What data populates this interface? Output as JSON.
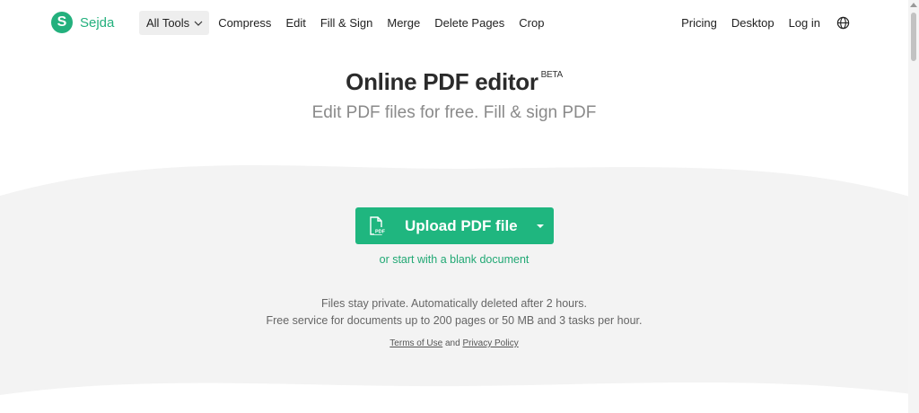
{
  "nav": {
    "logo_text": "Sejda",
    "logo_letter": "S",
    "all_tools": "All Tools",
    "links": [
      "Compress",
      "Edit",
      "Fill & Sign",
      "Merge",
      "Delete Pages",
      "Crop"
    ],
    "right_links": [
      "Pricing",
      "Desktop",
      "Log in"
    ],
    "icons": {
      "globe": "globe-icon",
      "chevron": "chevron-down-icon"
    }
  },
  "hero": {
    "title": "Online PDF editor",
    "badge": "BETA",
    "subtitle": "Edit PDF files for free. Fill & sign PDF"
  },
  "upload": {
    "label": "Upload PDF file",
    "icon": "pdf-file-icon",
    "icon_text": "PDF",
    "blank_link": "or start with a blank document"
  },
  "info": {
    "line1": "Files stay private. Automatically deleted after 2 hours.",
    "line2": "Free service for documents up to 200 pages or 50 MB and 3 tasks per hour.",
    "terms": "Terms of Use",
    "and": "and",
    "privacy": "Privacy Policy"
  },
  "colors": {
    "brand": "#1fb67f",
    "band": "#f3f3f3"
  }
}
